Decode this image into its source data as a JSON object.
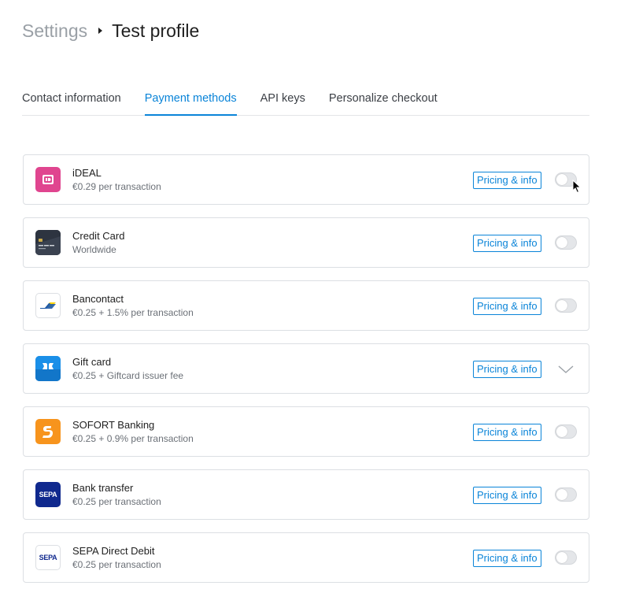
{
  "breadcrumb": {
    "parent": "Settings",
    "current": "Test profile"
  },
  "tabs": [
    {
      "label": "Contact information",
      "active": false
    },
    {
      "label": "Payment methods",
      "active": true
    },
    {
      "label": "API keys",
      "active": false
    },
    {
      "label": "Personalize checkout",
      "active": false
    }
  ],
  "methods": [
    {
      "name": "iDEAL",
      "detail": "€0.29 per transaction",
      "pricing_label": "Pricing & info",
      "control": "toggle",
      "enabled": false,
      "icon": "ideal-icon"
    },
    {
      "name": "Credit Card",
      "detail": "Worldwide",
      "pricing_label": "Pricing & info",
      "control": "toggle",
      "enabled": false,
      "icon": "credit-card-icon"
    },
    {
      "name": "Bancontact",
      "detail": "€0.25 + 1.5% per transaction",
      "pricing_label": "Pricing & info",
      "control": "toggle",
      "enabled": false,
      "icon": "bancontact-icon"
    },
    {
      "name": "Gift card",
      "detail": "€0.25 + Giftcard issuer fee",
      "pricing_label": "Pricing & info",
      "control": "expand",
      "enabled": false,
      "icon": "gift-card-icon"
    },
    {
      "name": "SOFORT Banking",
      "detail": "€0.25 + 0.9% per transaction",
      "pricing_label": "Pricing & info",
      "control": "toggle",
      "enabled": false,
      "icon": "sofort-icon"
    },
    {
      "name": "Bank transfer",
      "detail": "€0.25 per transaction",
      "pricing_label": "Pricing & info",
      "control": "toggle",
      "enabled": false,
      "icon": "sepa-icon",
      "logo_text": "SEPA"
    },
    {
      "name": "SEPA Direct Debit",
      "detail": "€0.25 per transaction",
      "pricing_label": "Pricing & info",
      "control": "toggle",
      "enabled": false,
      "icon": "sepa-direct-debit-icon",
      "logo_text": "SEPA"
    }
  ],
  "colors": {
    "accent": "#0a84d8",
    "ideal": "#e0458f",
    "credit_card": "#2d3440",
    "gift_card": "#1a8fe8",
    "sofort": "#f7941d",
    "sepa_blue": "#10298e"
  }
}
